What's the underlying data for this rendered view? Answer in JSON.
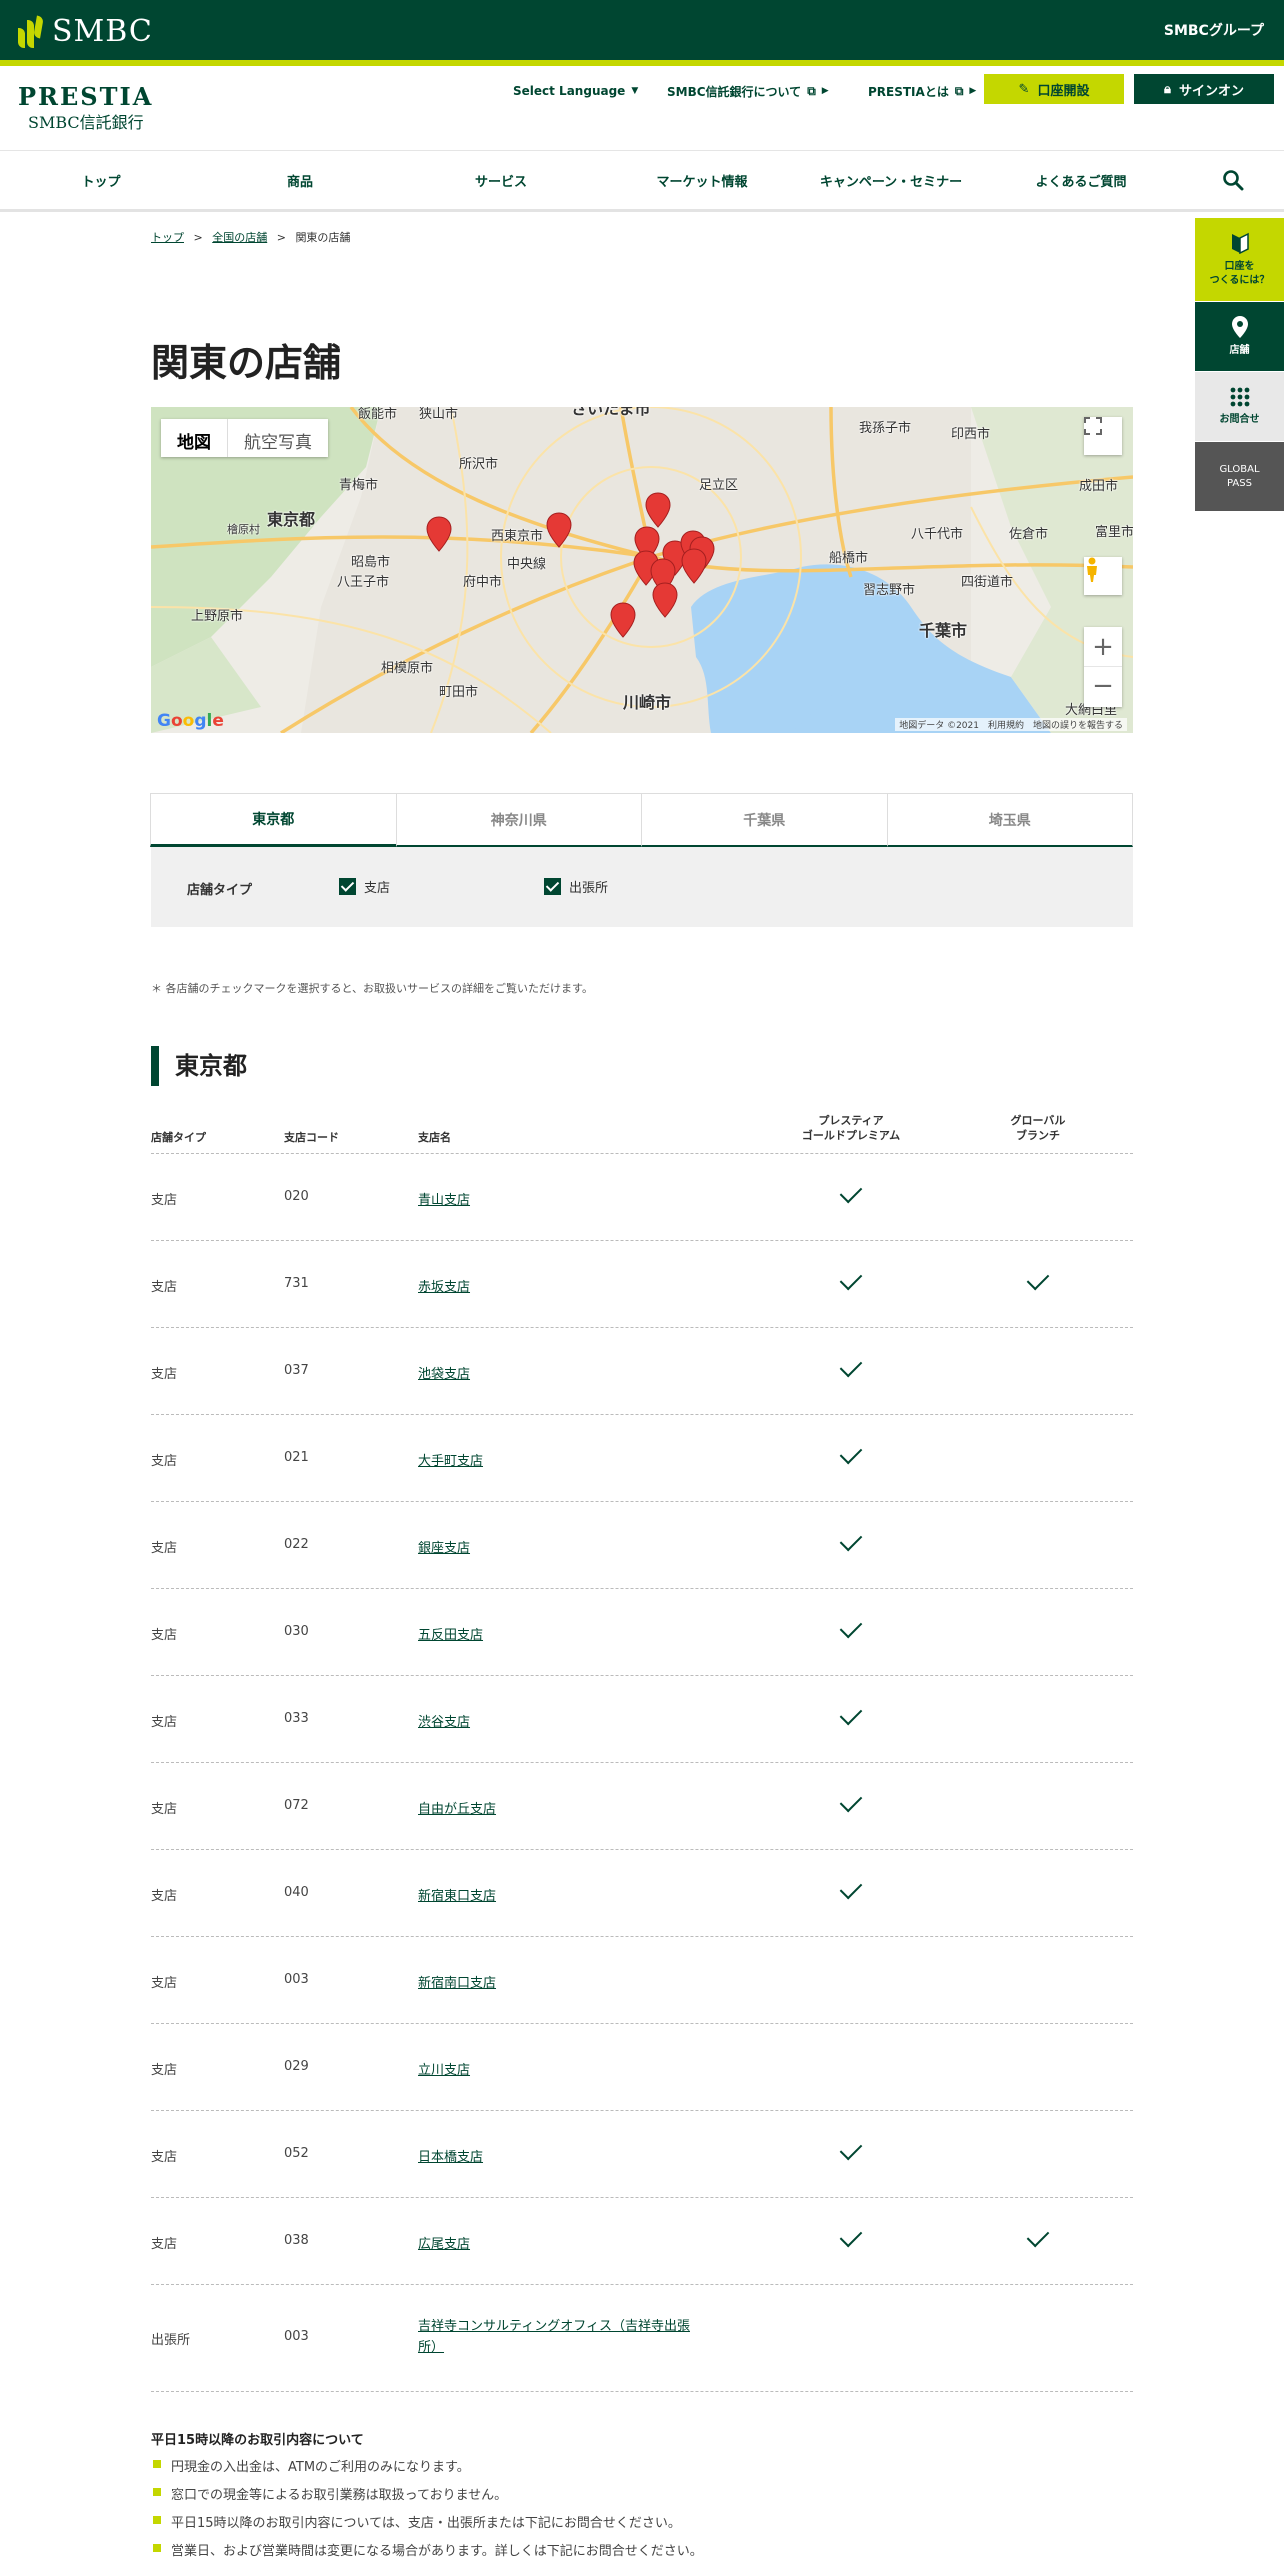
{
  "header": {
    "logo": "SMBC",
    "group_link": "SMBCグループ",
    "brand_name": "PRESTIA",
    "brand_bank": "SMBC信託銀行",
    "select_language": "Select Language",
    "about_bank": "SMBC信託銀行について",
    "about_prestia": "PRESTIAとは",
    "open_account": "口座開設",
    "sign_on": "サインオン"
  },
  "nav": {
    "items": [
      "トップ",
      "商品",
      "サービス",
      "マーケット情報",
      "キャンペーン・セミナー",
      "よくあるご質問"
    ]
  },
  "side": {
    "open_account_line1": "口座を",
    "open_account_line2": "つくるには？",
    "branches": "店舗",
    "contact": "お問合せ",
    "global_line1": "GLOBAL",
    "global_line2": "PASS"
  },
  "breadcrumb": {
    "top": "トップ",
    "all_branches": "全国の店舗",
    "current": "関東の店舗"
  },
  "page_title": "関東の店舗",
  "map": {
    "type_map": "地図",
    "type_satellite": "航空写真",
    "credit": "地図データ ©2021　利用規約　地図の誤りを報告する",
    "google": "Google",
    "zoom_in": "+",
    "zoom_out": "−",
    "labels": [
      {
        "text": "飯能市"
      },
      {
        "text": "狭山市"
      },
      {
        "text": "所沢市"
      },
      {
        "text": "さいたま市"
      },
      {
        "text": "我孫子市"
      },
      {
        "text": "印西市"
      },
      {
        "text": "青梅市"
      },
      {
        "text": "足立区"
      },
      {
        "text": "成田市"
      },
      {
        "text": "東京都"
      },
      {
        "text": "西東京市"
      },
      {
        "text": "八千代市"
      },
      {
        "text": "佐倉市"
      },
      {
        "text": "富里市"
      },
      {
        "text": "昭島市"
      },
      {
        "text": "中央線"
      },
      {
        "text": "船橋市"
      },
      {
        "text": "八王子市"
      },
      {
        "text": "府中市"
      },
      {
        "text": "四街道市"
      },
      {
        "text": "習志野市"
      },
      {
        "text": "上野原市"
      },
      {
        "text": "千葉市"
      },
      {
        "text": "相模原市"
      },
      {
        "text": "町田市"
      },
      {
        "text": "川崎市"
      },
      {
        "text": "大網白里"
      },
      {
        "text": "檜原村"
      }
    ]
  },
  "tabs": [
    "東京都",
    "神奈川県",
    "千葉県",
    "埼玉県"
  ],
  "filter": {
    "label": "店舗タイプ",
    "option1": "支店",
    "option2": "出張所"
  },
  "note": "＊ 各店舗のチェックマークを選択すると、お取扱いサービスの詳細をご覧いただけます。",
  "section_title": "東京都",
  "table": {
    "headers": {
      "type": "店舗タイプ",
      "code": "支店コード",
      "name": "支店名",
      "gold_line1": "プレスティア",
      "gold_line2": "ゴールドプレミアム",
      "global_line1": "グローバル",
      "global_line2": "ブランチ"
    },
    "rows": [
      {
        "type": "支店",
        "code": "020",
        "name": "青山支店",
        "gold": true,
        "global": false
      },
      {
        "type": "支店",
        "code": "731",
        "name": "赤坂支店",
        "gold": true,
        "global": true
      },
      {
        "type": "支店",
        "code": "037",
        "name": "池袋支店",
        "gold": true,
        "global": false
      },
      {
        "type": "支店",
        "code": "021",
        "name": "大手町支店",
        "gold": true,
        "global": false
      },
      {
        "type": "支店",
        "code": "022",
        "name": "銀座支店",
        "gold": true,
        "global": false
      },
      {
        "type": "支店",
        "code": "030",
        "name": "五反田支店",
        "gold": true,
        "global": false
      },
      {
        "type": "支店",
        "code": "033",
        "name": "渋谷支店",
        "gold": true,
        "global": false
      },
      {
        "type": "支店",
        "code": "072",
        "name": "自由が丘支店",
        "gold": true,
        "global": false
      },
      {
        "type": "支店",
        "code": "040",
        "name": "新宿東口支店",
        "gold": true,
        "global": false
      },
      {
        "type": "支店",
        "code": "003",
        "name": "新宿南口支店",
        "gold": false,
        "global": false
      },
      {
        "type": "支店",
        "code": "029",
        "name": "立川支店",
        "gold": false,
        "global": false
      },
      {
        "type": "支店",
        "code": "052",
        "name": "日本橋支店",
        "gold": true,
        "global": false
      },
      {
        "type": "支店",
        "code": "038",
        "name": "広尾支店",
        "gold": true,
        "global": true
      }
    ],
    "office": {
      "type": "出張所",
      "code": "003",
      "name_line1": "吉祥寺コンサルティングオフィス（吉祥寺出張",
      "name_line2": "所）"
    }
  },
  "notice": {
    "title": "平日15時以降のお取引内容について",
    "items": [
      "円現金の入出金は、ATMのご利用のみになります。",
      "窓口での現金等によるお取引業務は取扱っておりません。",
      "平日15時以降のお取引内容については、支店・出張所または下記にお問合せください。",
      "営業日、および営業時間は変更になる場合があります。詳しくは下記にお問合せください。"
    ]
  },
  "colors": {
    "brand_green": "#004631",
    "accent_lime": "#c4d700",
    "pin_red": "#e53935"
  }
}
